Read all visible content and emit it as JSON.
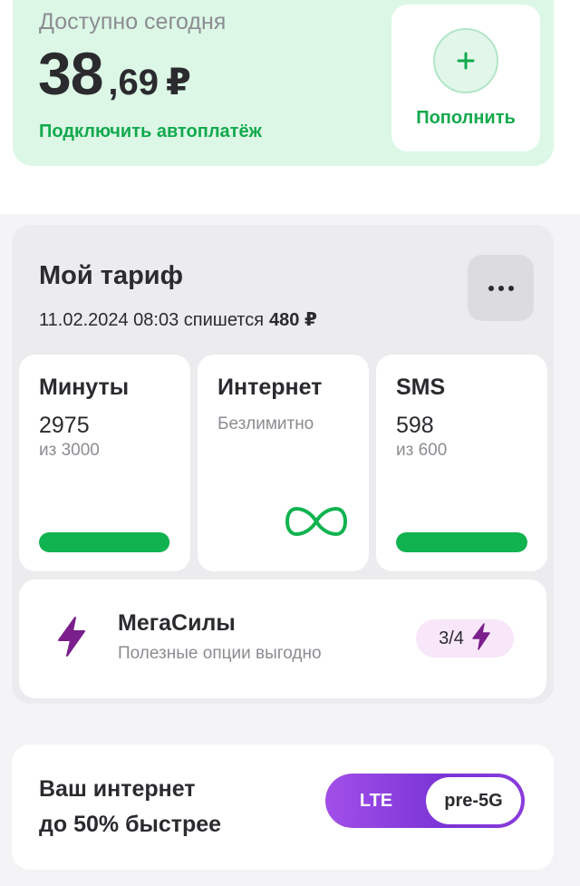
{
  "balance": {
    "label": "Доступно сегодня",
    "integer": "38",
    "fraction": ",69",
    "currency": "₽",
    "autopay_link": "Подключить автоплатёж",
    "topup_label": "Пополнить",
    "topup_icon": "plus-icon"
  },
  "tariff": {
    "title": "Мой тариф",
    "charge_date": "11.02.2024 08:03 спишется",
    "charge_amount": "480 ₽",
    "more_icon": "more-dots-icon",
    "minutes": {
      "name": "Минуты",
      "value": "2975",
      "limit": "из 3000",
      "fraction": 0.99
    },
    "internet": {
      "name": "Интернет",
      "note": "Безлимитно",
      "icon": "infinity-icon"
    },
    "sms": {
      "name": "SMS",
      "value": "598",
      "limit": "из 600",
      "fraction": 0.997
    },
    "megasily": {
      "title": "МегаСилы",
      "subtitle": "Полезные опции выгодно",
      "count": "3/4",
      "icon": "lightning-icon"
    }
  },
  "speed": {
    "line1": "Ваш интернет",
    "line2": "до 50% быстрее",
    "lte": "LTE",
    "pre5g": "pre-5G"
  },
  "colors": {
    "brand_green": "#10b34f",
    "accent_purple": "#7a1f8c",
    "balance_bg": "#dcf7e6"
  }
}
